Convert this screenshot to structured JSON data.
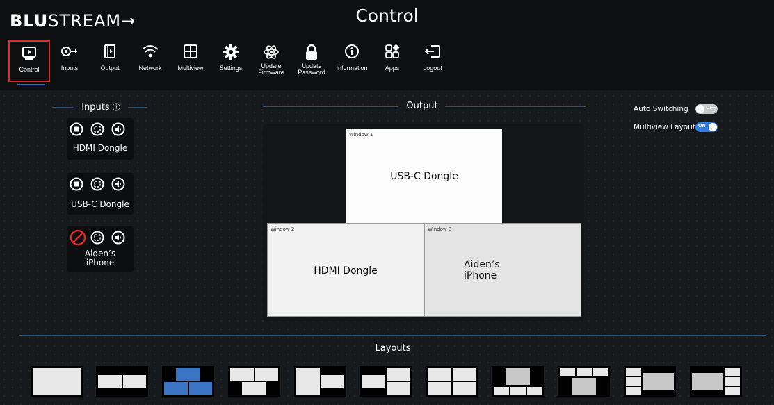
{
  "app": {
    "logo_bold": "BLU",
    "logo_thin": "STREAM",
    "page_title": "Control"
  },
  "nav": [
    {
      "label": "Control",
      "icon": "play-screen-icon",
      "active": true
    },
    {
      "label": "Inputs",
      "icon": "input-plug-icon"
    },
    {
      "label": "Output",
      "icon": "output-icon"
    },
    {
      "label": "Network",
      "icon": "wifi-icon"
    },
    {
      "label": "Multiview",
      "icon": "grid-icon"
    },
    {
      "label": "Settings",
      "icon": "gear-icon"
    },
    {
      "label": "Update\nFirmware",
      "icon": "atom-icon"
    },
    {
      "label": "Update\nPassword",
      "icon": "lock-icon"
    },
    {
      "label": "Information",
      "icon": "info-icon"
    },
    {
      "label": "Apps",
      "icon": "apps-icon"
    },
    {
      "label": "Logout",
      "icon": "logout-icon"
    }
  ],
  "inputs": {
    "title": "Inputs",
    "items": [
      {
        "name": "HDMI Dongle",
        "blocked": false
      },
      {
        "name": "USB-C Dongle",
        "blocked": false
      },
      {
        "name": "Aiden’s\niPhone",
        "blocked": true
      }
    ]
  },
  "output": {
    "title": "Output",
    "windows": [
      {
        "label": "Window 1",
        "source": "USB-C Dongle"
      },
      {
        "label": "Window 2",
        "source": "HDMI Dongle"
      },
      {
        "label": "Window 3",
        "source": "Aiden’s\niPhone"
      }
    ]
  },
  "toggles": {
    "auto_switching": {
      "label": "Auto Switching",
      "state": "OFF",
      "on": false
    },
    "multiview_layout": {
      "label": "Multiview Layout",
      "state": "ON",
      "on": true
    }
  },
  "layouts": {
    "title": "Layouts",
    "selected_index": 2,
    "count": 11
  },
  "colors": {
    "accent": "#2a6fb8",
    "active_outline": "#e0292b",
    "blocked": "#e0292b",
    "selected_layout": "#3b74c4"
  }
}
